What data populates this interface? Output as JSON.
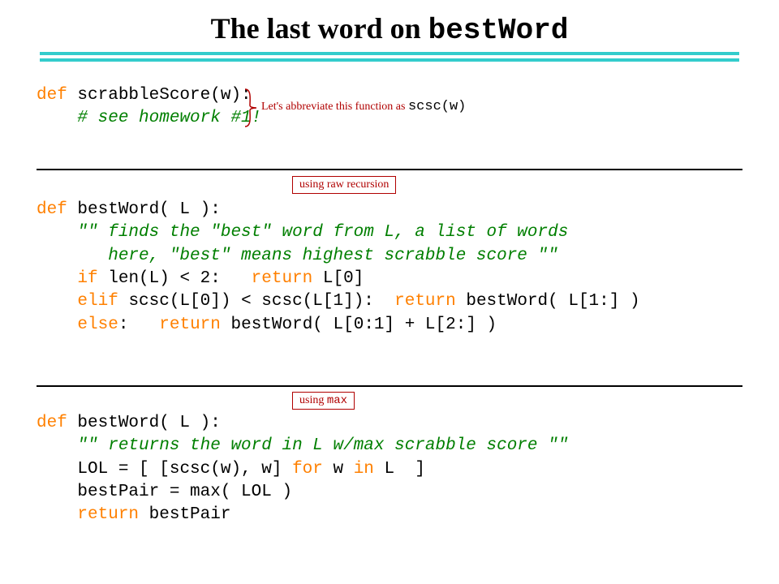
{
  "title_prefix": "The last word on ",
  "title_code": "bestWord",
  "annot_brace_text": "Let's abbreviate this function as ",
  "annot_brace_code": "scsc(w)",
  "label_recursion": "using raw recursion",
  "label_max_prefix": "using ",
  "label_max_code": "max",
  "code1": {
    "l1_kw": "def",
    "l1_rest": " scrabbleScore(w):",
    "l2_indent": "    ",
    "l2_cm": "# see homework #1!"
  },
  "code2": {
    "l1_kw": "def",
    "l1_rest": " bestWord( L ):",
    "l2_indent": "    ",
    "l2_cm": "\"\" finds the \"best\" word from L, a list of words",
    "l3_indent": "       ",
    "l3_cm": "here, \"best\" means highest scrabble score \"\"",
    "l4_indent": "    ",
    "l4_kw1": "if",
    "l4_mid": " len(L) < 2:   ",
    "l4_kw2": "return",
    "l4_end": " L[0]",
    "l5_indent": "    ",
    "l5_kw1": "elif",
    "l5_mid": " scsc(L[0]) < scsc(L[1]):  ",
    "l5_kw2": "return",
    "l5_end": " bestWord( L[1:] )",
    "l6_indent": "    ",
    "l6_kw1": "else",
    "l6_mid": ":   ",
    "l6_kw2": "return",
    "l6_end": " bestWord( L[0:1] + L[2:] )"
  },
  "code3": {
    "l1_kw": "def",
    "l1_rest": " bestWord( L ):",
    "l2_indent": "    ",
    "l2_cm": "\"\" returns the word in L w/max scrabble score \"\"",
    "l3_indent": "    ",
    "l3_a": "LOL = [ [scsc(w), w] ",
    "l3_kw1": "for",
    "l3_b": " w ",
    "l3_kw2": "in",
    "l3_c": " L  ]",
    "l4_indent": "    ",
    "l4": "bestPair = max( LOL )",
    "l5_indent": "    ",
    "l5_kw": "return",
    "l5_end": " bestPair"
  }
}
